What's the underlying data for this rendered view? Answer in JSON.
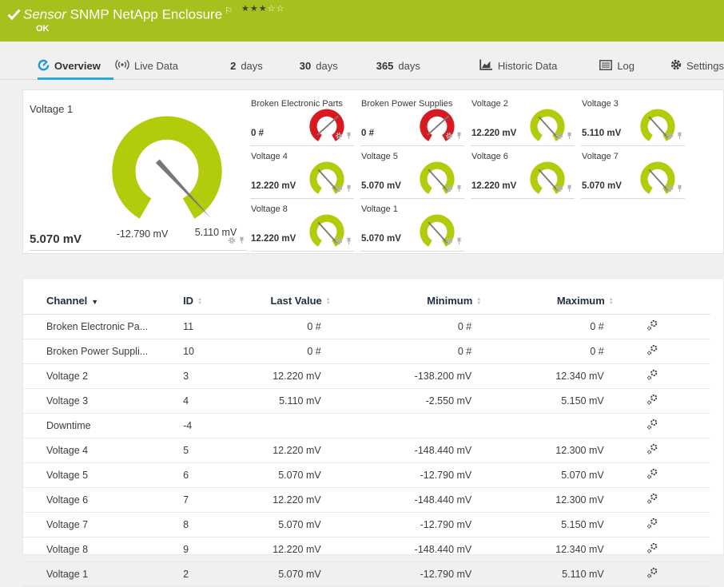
{
  "header": {
    "kind_label": "Sensor",
    "title": "SNMP NetApp Enclosure",
    "status_text": "OK",
    "rating": {
      "filled": 3,
      "total": 5
    },
    "flag_glyph": "⚐"
  },
  "tabs": {
    "items": [
      {
        "label": "Overview",
        "active": true
      },
      {
        "label": "Live Data"
      },
      {
        "num": "2",
        "word": "days"
      },
      {
        "num": "30",
        "word": "days"
      },
      {
        "num": "365",
        "word": "days"
      },
      {
        "label": "Historic Data"
      },
      {
        "label": "Log"
      },
      {
        "label": "Settings"
      }
    ]
  },
  "gauges": {
    "primary": {
      "title": "Voltage 1",
      "value": "5.070 mV",
      "min_label": "-12.790 mV",
      "max_label": "5.110 mV",
      "color": "#b2cb0b",
      "needle_deg": -47
    },
    "tiles": [
      {
        "title": "Broken Electronic Parts",
        "value": "0 #",
        "color": "#d71920",
        "needle_deg": 42
      },
      {
        "title": "Broken Power Supplies",
        "value": "0 #",
        "color": "#d71920",
        "needle_deg": 42
      },
      {
        "title": "Voltage 2",
        "value": "12.220 mV",
        "color": "#b2cb0b",
        "needle_deg": -48
      },
      {
        "title": "Voltage 3",
        "value": "5.110 mV",
        "color": "#b2cb0b",
        "needle_deg": -48
      },
      {
        "title": "Voltage 4",
        "value": "12.220 mV",
        "color": "#b2cb0b",
        "needle_deg": -48
      },
      {
        "title": "Voltage 5",
        "value": "5.070 mV",
        "color": "#b2cb0b",
        "needle_deg": -48
      },
      {
        "title": "Voltage 6",
        "value": "12.220 mV",
        "color": "#b2cb0b",
        "needle_deg": -48
      },
      {
        "title": "Voltage 7",
        "value": "5.070 mV",
        "color": "#b2cb0b",
        "needle_deg": -48
      },
      {
        "title": "Voltage 8",
        "value": "12.220 mV",
        "color": "#b2cb0b",
        "needle_deg": -48
      },
      {
        "title": "Voltage 1",
        "value": "5.070 mV",
        "color": "#b2cb0b",
        "needle_deg": -48
      }
    ]
  },
  "table": {
    "columns": [
      {
        "label": "Channel",
        "sort": "desc"
      },
      {
        "label": "ID",
        "sort": "none"
      },
      {
        "label": "Last Value",
        "sort": "none"
      },
      {
        "label": "Minimum",
        "sort": "none"
      },
      {
        "label": "Maximum",
        "sort": "none"
      }
    ],
    "rows": [
      {
        "channel": "Broken Electronic Pa...",
        "id": "11",
        "last": "0 #",
        "min": "0 #",
        "max": "0 #"
      },
      {
        "channel": "Broken Power Suppli...",
        "id": "10",
        "last": "0 #",
        "min": "0 #",
        "max": "0 #"
      },
      {
        "channel": "Voltage 2",
        "id": "3",
        "last": "12.220 mV",
        "min": "-138.200 mV",
        "max": "12.340 mV"
      },
      {
        "channel": "Voltage 3",
        "id": "4",
        "last": "5.110 mV",
        "min": "-2.550 mV",
        "max": "5.150 mV"
      },
      {
        "channel": "Downtime",
        "id": "-4",
        "last": "",
        "min": "",
        "max": ""
      },
      {
        "channel": "Voltage 4",
        "id": "5",
        "last": "12.220 mV",
        "min": "-148.440 mV",
        "max": "12.300 mV"
      },
      {
        "channel": "Voltage 5",
        "id": "6",
        "last": "5.070 mV",
        "min": "-12.790 mV",
        "max": "5.070 mV"
      },
      {
        "channel": "Voltage 6",
        "id": "7",
        "last": "12.220 mV",
        "min": "-148.440 mV",
        "max": "12.300 mV"
      },
      {
        "channel": "Voltage 7",
        "id": "8",
        "last": "5.070 mV",
        "min": "-12.790 mV",
        "max": "5.150 mV"
      },
      {
        "channel": "Voltage 8",
        "id": "9",
        "last": "12.220 mV",
        "min": "-148.440 mV",
        "max": "12.340 mV"
      },
      {
        "channel": "Voltage 1",
        "id": "2",
        "last": "5.070 mV",
        "min": "-12.790 mV",
        "max": "5.110 mV"
      }
    ]
  },
  "colors": {
    "header_bg": "#a7c01d",
    "accent_blue": "#28a8e0",
    "gauge_green": "#b2cb0b",
    "gauge_red": "#d71920",
    "needle_gray": "#777777",
    "page_bg": "#f0f0f0"
  }
}
